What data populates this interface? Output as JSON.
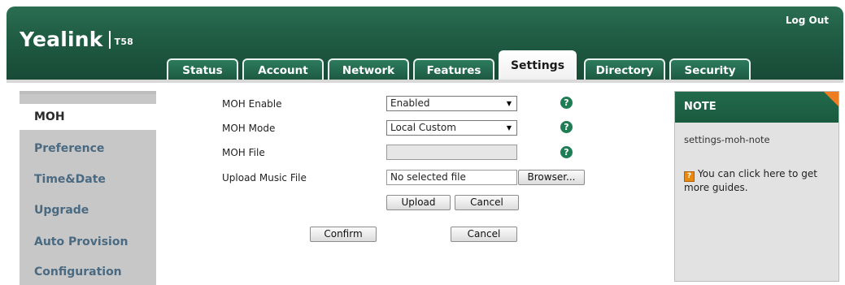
{
  "header": {
    "brand": "Yealink",
    "model": "T58",
    "logout_label": "Log Out"
  },
  "tabs": [
    {
      "label": "Status",
      "active": false
    },
    {
      "label": "Account",
      "active": false
    },
    {
      "label": "Network",
      "active": false
    },
    {
      "label": "Features",
      "active": false
    },
    {
      "label": "Settings",
      "active": true
    },
    {
      "label": "Directory",
      "active": false
    },
    {
      "label": "Security",
      "active": false
    }
  ],
  "sidebar": {
    "items": [
      {
        "label": "MOH",
        "active": true
      },
      {
        "label": "Preference",
        "active": false
      },
      {
        "label": "Time&Date",
        "active": false
      },
      {
        "label": "Upgrade",
        "active": false
      },
      {
        "label": "Auto Provision",
        "active": false
      },
      {
        "label": "Configuration",
        "active": false
      }
    ]
  },
  "form": {
    "moh_enable": {
      "label": "MOH Enable",
      "value": "Enabled"
    },
    "moh_mode": {
      "label": "MOH Mode",
      "value": "Local Custom"
    },
    "moh_file": {
      "label": "MOH File",
      "value": ""
    },
    "upload_music_file": {
      "label": "Upload Music File",
      "value": "No selected file",
      "browse_label": "Browser..."
    },
    "upload_label": "Upload",
    "upload_cancel_label": "Cancel",
    "confirm_label": "Confirm",
    "cancel_label": "Cancel",
    "help_symbol": "?"
  },
  "note": {
    "title": "NOTE",
    "text": "settings-moh-note",
    "guide_icon": "?",
    "guide_text": "You can click here to get more guides."
  },
  "colors": {
    "header_green": "#1f5b42",
    "help_green": "#1f7d55",
    "note_corner_orange": "#ee7d21",
    "sidebar_gray": "#c7c7c7",
    "sidebar_link": "#4a6a82"
  }
}
